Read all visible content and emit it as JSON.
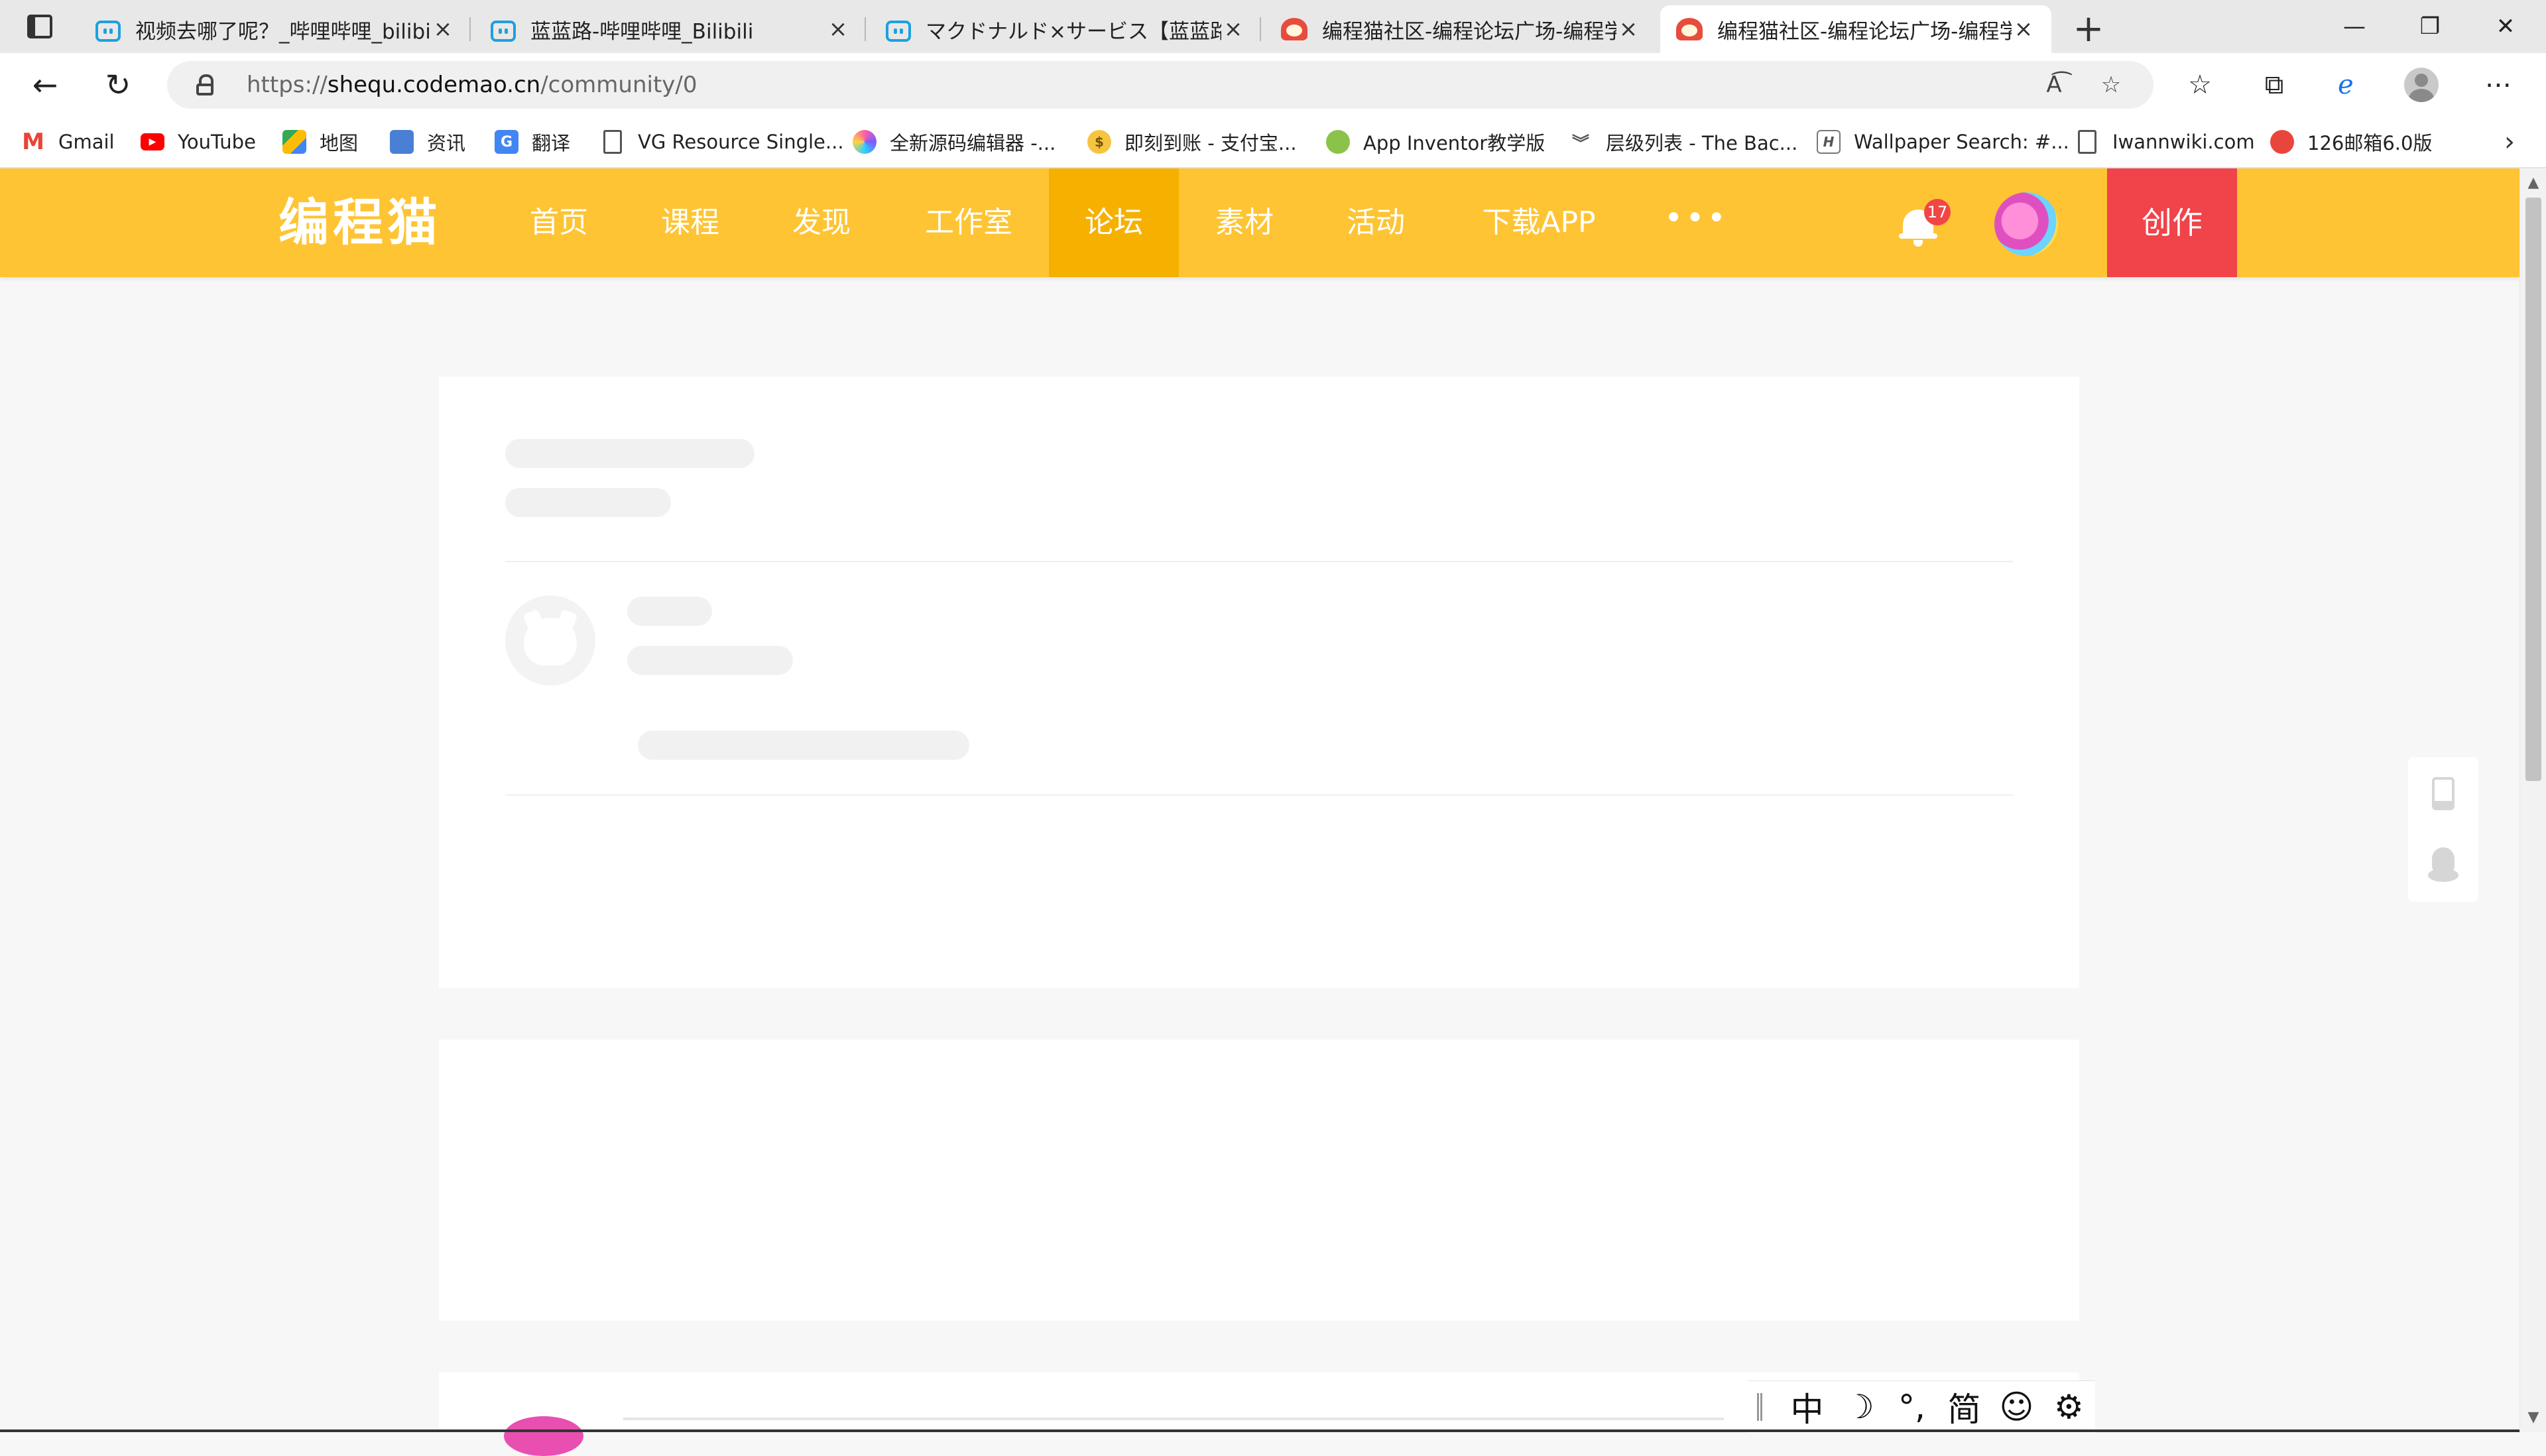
{
  "tabs": [
    {
      "title": "视频去哪了呢？_哔哩哔哩_bilibili",
      "icon": "bilibili-icon"
    },
    {
      "title": "蓝蓝路-哔哩哔哩_Bilibili",
      "icon": "bilibili-icon"
    },
    {
      "title": "マクドナルド×サービス【蓝蓝路",
      "icon": "bilibili-icon"
    },
    {
      "title": "编程猫社区-编程论坛广场-编程学",
      "icon": "codemao-icon"
    },
    {
      "title": "编程猫社区-编程论坛广场-编程学",
      "icon": "codemao-icon",
      "active": true
    }
  ],
  "address": {
    "url_prefix": "https://",
    "url_domain": "shequ.codemao.cn",
    "url_path": "/community/0"
  },
  "bookmarks": [
    {
      "label": "Gmail",
      "icon": "gmail-icon"
    },
    {
      "label": "YouTube",
      "icon": "youtube-icon"
    },
    {
      "label": "地图",
      "icon": "maps-icon"
    },
    {
      "label": "资讯",
      "icon": "news-icon"
    },
    {
      "label": "翻译",
      "icon": "translate-icon"
    },
    {
      "label": "VG Resource Single...",
      "icon": "page-icon"
    },
    {
      "label": "全新源码编辑器 -...",
      "icon": "editor-icon"
    },
    {
      "label": "即刻到账 - 支付宝...",
      "icon": "money-bag-icon"
    },
    {
      "label": "App Inventor教学版",
      "icon": "app-inventor-icon"
    },
    {
      "label": "层级列表 - The Bac...",
      "icon": "wing-icon"
    },
    {
      "label": "Wallpaper Search: #...",
      "icon": "wallpaper-icon"
    },
    {
      "label": "Iwannwiki.com",
      "icon": "page-icon"
    },
    {
      "label": "126邮箱6.0版",
      "icon": "mail-126-icon"
    }
  ],
  "site": {
    "logo": "编程猫",
    "nav": [
      "首页",
      "课程",
      "发现",
      "工作室",
      "论坛",
      "素材",
      "活动",
      "下载APP"
    ],
    "active_nav": "论坛",
    "more": "•••",
    "notification_count": "17",
    "create_label": "创作"
  },
  "ime": {
    "items": [
      "中",
      "☽",
      "°,",
      "简",
      "☺",
      "⚙"
    ]
  },
  "colors": {
    "header": "#fec433",
    "header_active": "#f6b000",
    "create": "#f0434a",
    "badge": "#f04646"
  }
}
